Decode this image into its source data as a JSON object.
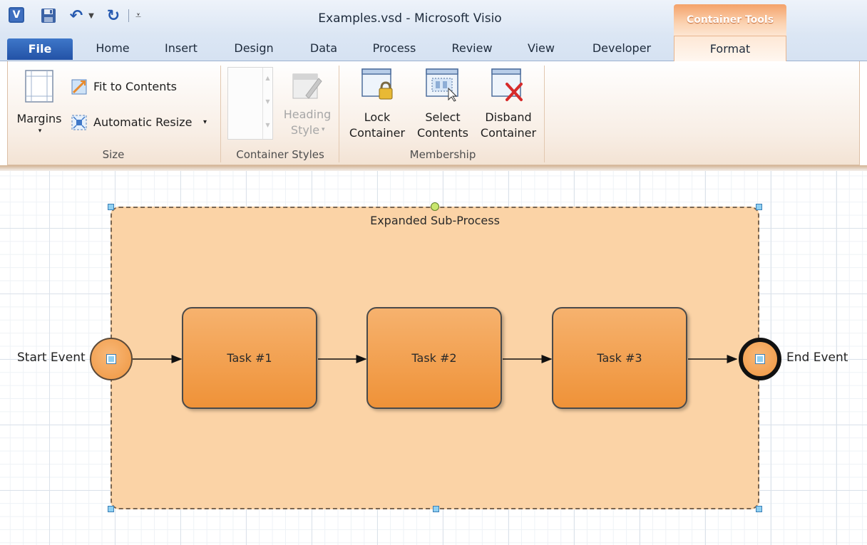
{
  "window": {
    "title": "Examples.vsd  -  Microsoft Visio",
    "app_logo": "V",
    "context_tab_header": "Container Tools"
  },
  "quick_access": {
    "icons": [
      "visio-logo-icon",
      "save-icon",
      "undo-icon",
      "redo-icon",
      "customize-toolbar-icon"
    ]
  },
  "tabs": {
    "file": "File",
    "home": "Home",
    "insert": "Insert",
    "design": "Design",
    "data": "Data",
    "process": "Process",
    "review": "Review",
    "view": "View",
    "developer": "Developer",
    "format": "Format"
  },
  "ribbon": {
    "size_group": {
      "label": "Size",
      "margins": "Margins",
      "fit_to_contents": "Fit to Contents",
      "automatic_resize": "Automatic Resize",
      "dropdown_glyph": "▾"
    },
    "styles_group": {
      "label": "Container Styles",
      "heading_style_line1": "Heading",
      "heading_style_line2": "Style",
      "dropdown_glyph": "▾"
    },
    "membership_group": {
      "label": "Membership",
      "lock_line1": "Lock",
      "lock_line2": "Container",
      "select_line1": "Select",
      "select_line2": "Contents",
      "disband_line1": "Disband",
      "disband_line2": "Container"
    }
  },
  "diagram": {
    "container_title": "Expanded Sub-Process",
    "start_event": "Start Event",
    "end_event": "End Event",
    "tasks": [
      "Task #1",
      "Task #2",
      "Task #3"
    ]
  },
  "colors": {
    "container_fill": "#fbd3a6",
    "task_fill": "#f3a457",
    "file_tab": "#2f63b7",
    "context_tab": "#f4a26a"
  }
}
